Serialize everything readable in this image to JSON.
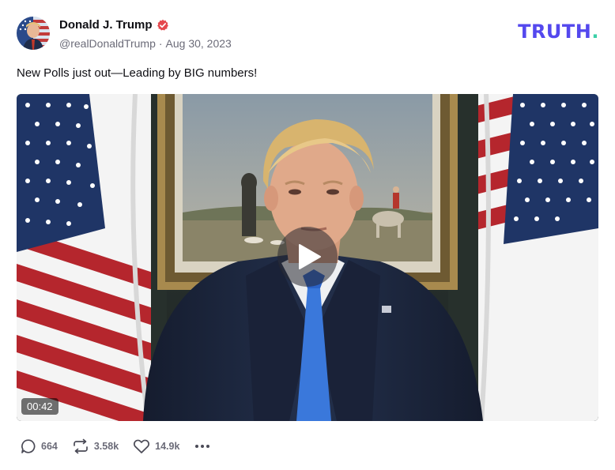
{
  "author": {
    "display_name": "Donald J. Trump",
    "handle": "@realDonaldTrump",
    "separator": "·",
    "date": "Aug 30, 2023",
    "verified_icon": "verified-badge-icon",
    "verified_color": "#e5484d"
  },
  "brand": {
    "logo_text": "TRUTH",
    "logo_dot": ".",
    "logo_color": "#5448ee",
    "dot_color": "#3bd0a8"
  },
  "post": {
    "text": "New Polls just out—Leading by BIG numbers!"
  },
  "video": {
    "duration": "00:42",
    "play_icon": "play-icon"
  },
  "actions": {
    "replies": {
      "icon": "reply-icon",
      "count": "664"
    },
    "retruths": {
      "icon": "retruth-icon",
      "count": "3.58k"
    },
    "likes": {
      "icon": "heart-icon",
      "count": "14.9k"
    },
    "more": {
      "icon": "more-icon"
    }
  }
}
